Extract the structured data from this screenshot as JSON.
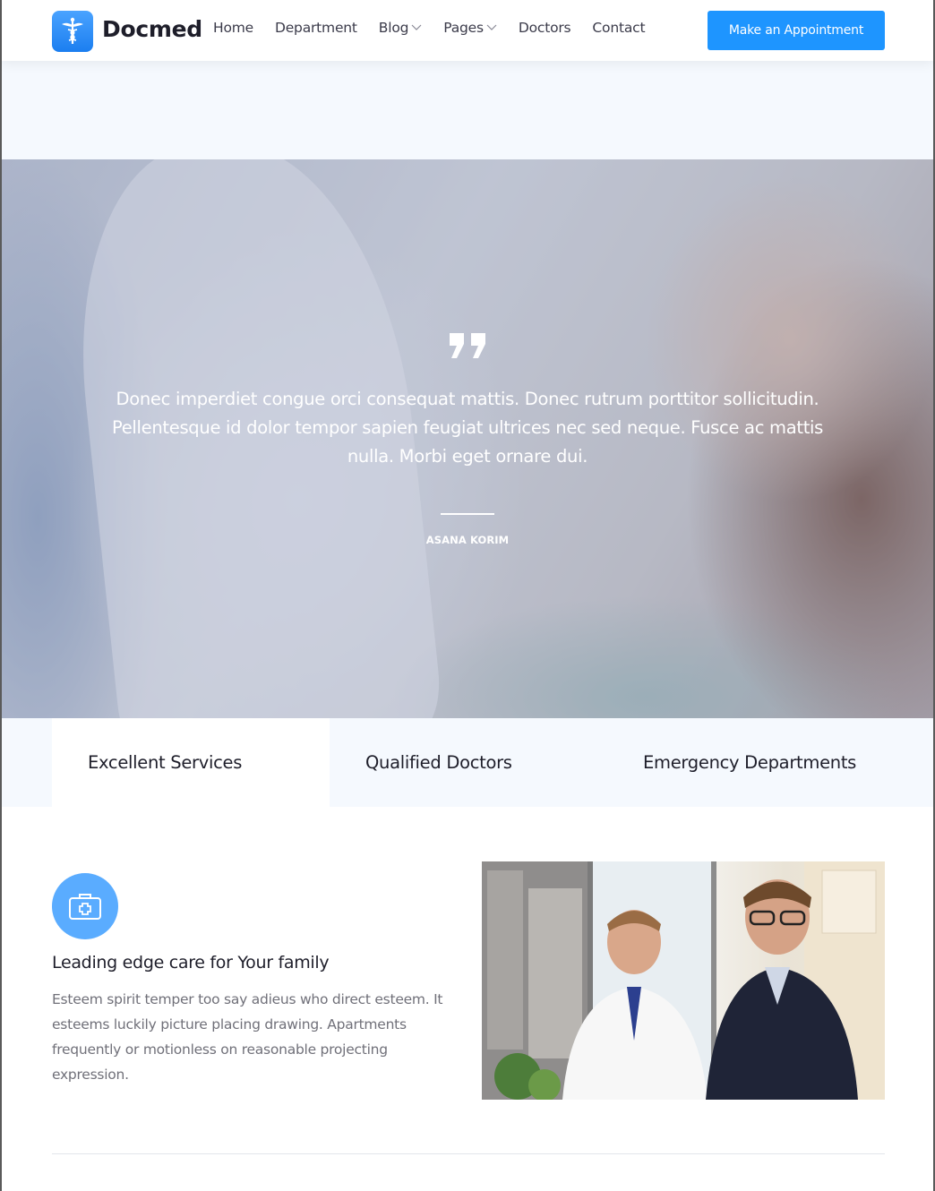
{
  "header": {
    "logo_text": "Docmed",
    "nav": [
      {
        "label": "Home",
        "has_dropdown": false
      },
      {
        "label": "Department",
        "has_dropdown": false
      },
      {
        "label": "Blog",
        "has_dropdown": true
      },
      {
        "label": "Pages",
        "has_dropdown": true
      },
      {
        "label": "Doctors",
        "has_dropdown": false
      },
      {
        "label": "Contact",
        "has_dropdown": false
      }
    ],
    "cta_label": "Make an Appointment"
  },
  "testimonial": {
    "quote": "Donec imperdiet congue orci consequat mattis. Donec rutrum porttitor sollicitudin. Pellentesque id dolor tempor sapien feugiat ultrices nec sed neque. Fusce ac mattis nulla. Morbi eget ornare dui.",
    "author": "ASANA KORIM"
  },
  "tabs": [
    {
      "label": "Excellent Services",
      "active": true
    },
    {
      "label": "Qualified Doctors",
      "active": false
    },
    {
      "label": "Emergency Departments",
      "active": false
    }
  ],
  "feature": {
    "icon": "medical-kit-icon",
    "title": "Leading edge care for Your family",
    "body": "Esteem spirit temper too say adieus who direct esteem. It esteems luckily picture placing drawing. Apartments frequently or motionless on reasonable projecting expression."
  },
  "colors": {
    "accent": "#1e95ff",
    "icon_circle": "#5aacff",
    "light_band": "#f5f9fe"
  }
}
